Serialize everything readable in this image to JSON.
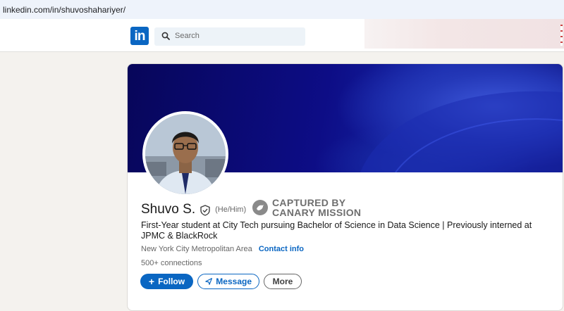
{
  "browser": {
    "url": "linkedin.com/in/shuvoshahariyer/"
  },
  "header": {
    "logo": "in",
    "search_placeholder": "Search"
  },
  "profile": {
    "name": "Shuvo S.",
    "pronouns": "(He/Him)",
    "headline": "First-Year student at City Tech pursuing Bachelor of Science in Data Science | Previously interned at JPMC & BlackRock",
    "location": "New York City Metropolitan Area",
    "contact_label": "Contact info",
    "connections": "500+ connections"
  },
  "stamp": {
    "line1": "CAPTURED BY",
    "line2": "CANARY MISSION"
  },
  "actions": {
    "follow": "Follow",
    "message": "Message",
    "more": "More"
  },
  "colors": {
    "brand": "#0a66c2",
    "banner_dark": "#07065a",
    "page_bg": "#f4f2ee"
  }
}
